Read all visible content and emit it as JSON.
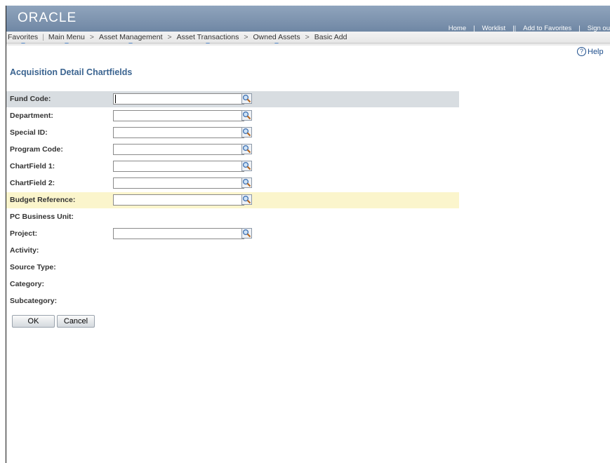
{
  "header": {
    "logo": "ORACLE",
    "links": [
      "Home",
      "Worklist",
      "Add to Favorites",
      "Sign ou"
    ]
  },
  "breadcrumb": {
    "items": [
      "Favorites",
      "Main Menu",
      "Asset Management",
      "Asset Transactions",
      "Owned Assets",
      "Basic Add"
    ]
  },
  "help": {
    "label": "Help"
  },
  "page": {
    "title": "Acquisition Detail Chartfields"
  },
  "form": {
    "fund_code": {
      "label": "Fund Code:",
      "value": ""
    },
    "department": {
      "label": "Department:",
      "value": ""
    },
    "special_id": {
      "label": "Special ID:",
      "value": ""
    },
    "program_code": {
      "label": "Program Code:",
      "value": ""
    },
    "chartfield_1": {
      "label": "ChartField 1:",
      "value": ""
    },
    "chartfield_2": {
      "label": "ChartField 2:",
      "value": ""
    },
    "budget_reference": {
      "label": "Budget Reference:",
      "value": ""
    },
    "pc_business_unit": {
      "label": "PC Business Unit:"
    },
    "project": {
      "label": "Project:",
      "value": ""
    },
    "activity": {
      "label": "Activity:"
    },
    "source_type": {
      "label": "Source Type:"
    },
    "category": {
      "label": "Category:"
    },
    "subcategory": {
      "label": "Subcategory:"
    }
  },
  "buttons": {
    "ok": "OK",
    "cancel": "Cancel"
  },
  "icons": {
    "lookup": "magnifier-lookup-icon",
    "help": "help-circle-icon"
  },
  "colors": {
    "banner": "#7d93ae",
    "title": "#3b6490",
    "row_highlight_grey": "#d8dde1",
    "row_highlight_yellow": "#fbf5cc"
  }
}
